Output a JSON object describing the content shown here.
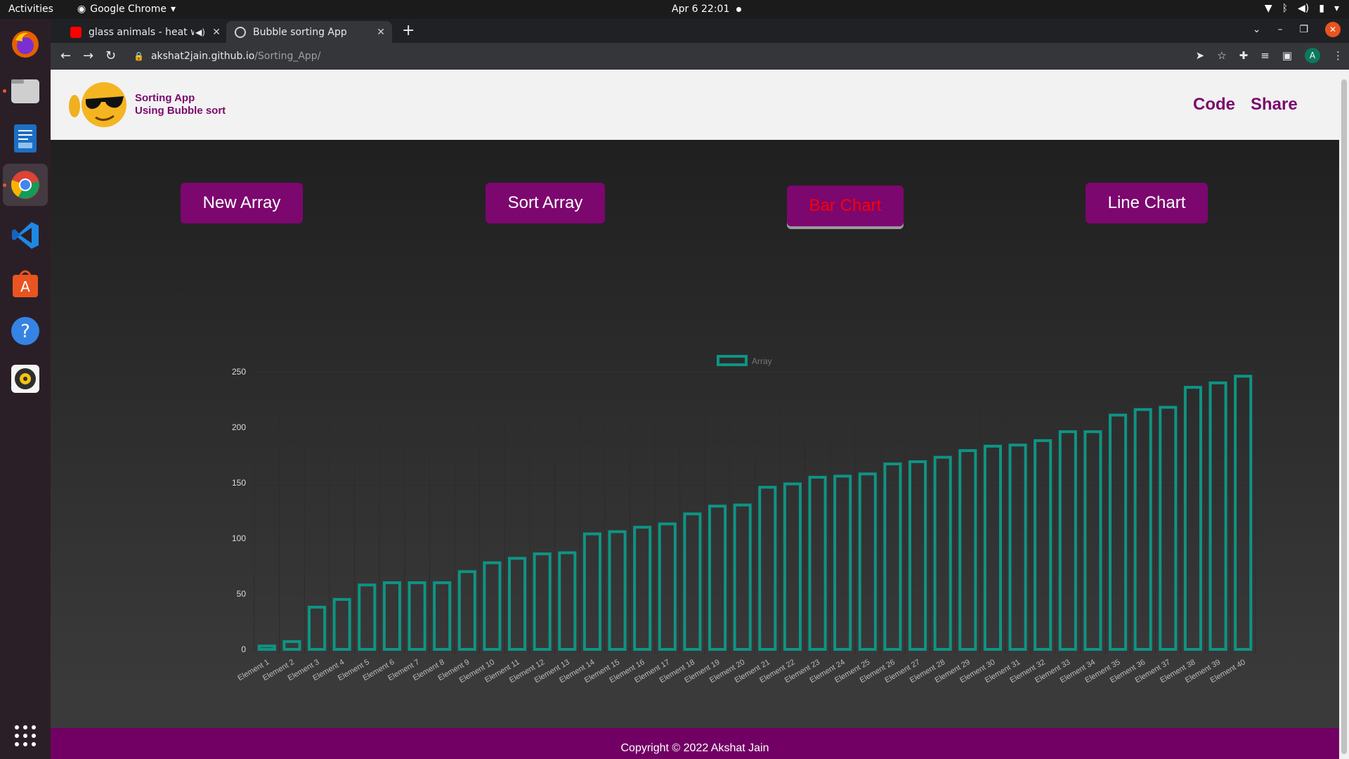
{
  "system": {
    "activities": "Activities",
    "app_name": "Google Chrome",
    "clock": "Apr 6  22:01"
  },
  "browser": {
    "tabs": [
      {
        "title": "glass animals - heat wa",
        "favicon": "youtube-icon",
        "active": false
      },
      {
        "title": "Bubble sorting App",
        "favicon": "globe-icon",
        "active": true
      }
    ],
    "url_host": "akshat2jain.github.io",
    "url_path": "/Sorting_App/",
    "profile_initial": "A"
  },
  "header": {
    "brand_line1": "Sorting App",
    "brand_line2": "Using Bubble sort",
    "links": [
      "Code",
      "Share"
    ]
  },
  "controls": {
    "new_array": "New Array",
    "sort_array": "Sort Array",
    "bar_chart": "Bar Chart",
    "line_chart": "Line Chart"
  },
  "colors": {
    "accent": "#7c076f",
    "bar": "#0e9484",
    "active_text": "#ff0000"
  },
  "chart_data": {
    "type": "bar",
    "legend": [
      "Array"
    ],
    "legend_position": "top",
    "ylim": [
      0,
      250
    ],
    "yticks": [
      0,
      50,
      100,
      150,
      200,
      250
    ],
    "grid": true,
    "categories": [
      "Element 1",
      "Element 2",
      "Element 3",
      "Element 4",
      "Element 5",
      "Element 6",
      "Element 7",
      "Element 8",
      "Element 9",
      "Element 10",
      "Element 11",
      "Element 12",
      "Element 13",
      "Element 14",
      "Element 15",
      "Element 16",
      "Element 17",
      "Element 18",
      "Element 19",
      "Element 20",
      "Element 21",
      "Element 22",
      "Element 23",
      "Element 24",
      "Element 25",
      "Element 26",
      "Element 27",
      "Element 28",
      "Element 29",
      "Element 30",
      "Element 31",
      "Element 32",
      "Element 33",
      "Element 34",
      "Element 35",
      "Element 36",
      "Element 37",
      "Element 38",
      "Element 39",
      "Element 40"
    ],
    "series": [
      {
        "name": "Array",
        "values": [
          3,
          7,
          38,
          45,
          58,
          60,
          60,
          60,
          70,
          78,
          82,
          86,
          87,
          104,
          106,
          110,
          113,
          122,
          129,
          130,
          146,
          149,
          155,
          156,
          158,
          167,
          169,
          173,
          179,
          183,
          184,
          188,
          196,
          196,
          211,
          216,
          218,
          236,
          240,
          246
        ]
      }
    ]
  },
  "footer": {
    "copyright": "Copyright © 2022 Akshat Jain"
  }
}
